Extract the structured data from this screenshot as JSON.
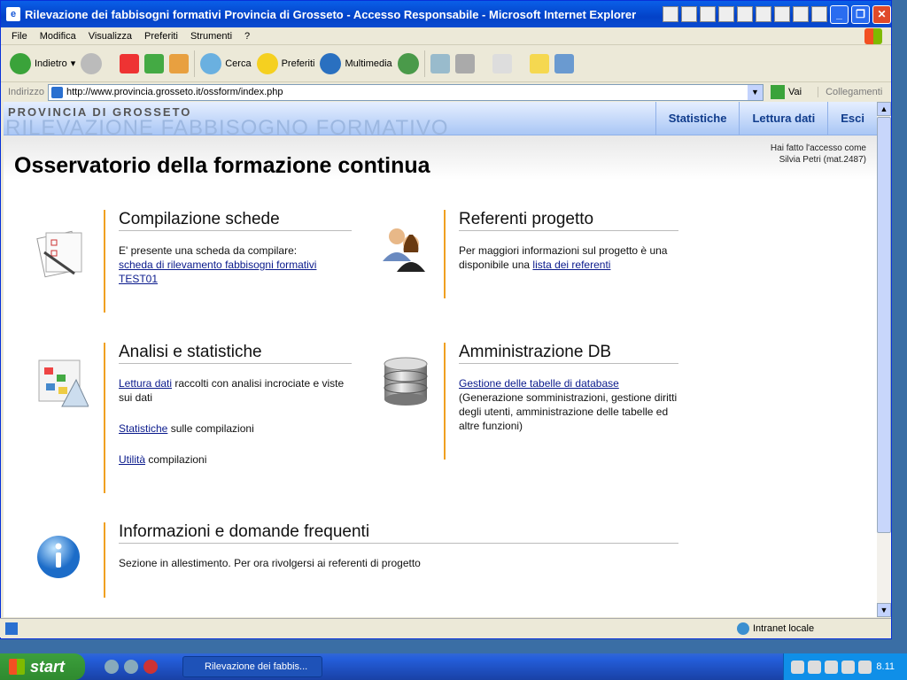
{
  "window": {
    "title": "Rilevazione dei fabbisogni formativi Provincia di Grosseto - Accesso Responsabile - Microsoft Internet Explorer"
  },
  "menu": [
    "File",
    "Modifica",
    "Visualizza",
    "Preferiti",
    "Strumenti",
    "?"
  ],
  "toolbar": {
    "back": "Indietro",
    "search": "Cerca",
    "favorites": "Preferiti",
    "media": "Multimedia"
  },
  "address": {
    "label": "Indirizzo",
    "url": "http://www.provincia.grosseto.it/ossform/index.php",
    "go": "Vai",
    "links": "Collegamenti"
  },
  "banner": {
    "line1": "PROVINCIA DI GROSSETO",
    "line2": "RILEVAZIONE FABBISOGNO FORMATIVO"
  },
  "nav": [
    "Statistiche",
    "Lettura dati",
    "Esci"
  ],
  "header": {
    "title": "Osservatorio della formazione continua",
    "login_line1": "Hai fatto l'accesso come",
    "login_line2": "Silvia Petri (mat.2487)"
  },
  "sections": {
    "compilazione": {
      "title": "Compilazione schede",
      "text": "E' presente una scheda da compilare:",
      "link": "scheda di rilevamento fabbisogni formativi TEST01"
    },
    "referenti": {
      "title": "Referenti progetto",
      "text": "Per maggiori informazioni sul progetto è una disponibile una ",
      "link": "lista dei referenti"
    },
    "analisi": {
      "title": "Analisi e statistiche",
      "link1": "Lettura dati",
      "text1": " raccolti con analisi incrociate e viste sui dati",
      "link2": "Statistiche",
      "text2": " sulle compilazioni",
      "link3": "Utilità",
      "text3": " compilazioni"
    },
    "admin": {
      "title": "Amministrazione DB",
      "link": "Gestione delle tabelle di database",
      "text": "(Generazione somministrazioni, gestione diritti degli utenti, amministrazione delle tabelle ed altre funzioni)"
    },
    "info": {
      "title": "Informazioni e domande frequenti",
      "text": "Sezione in allestimento. Per ora rivolgersi ai referenti di progetto"
    }
  },
  "status": {
    "zone": "Intranet locale"
  },
  "taskbar": {
    "start": "start",
    "task": "Rilevazione dei fabbis...",
    "clock": "8.11"
  },
  "colors": {
    "accent_bar": "#f0a020",
    "link": "#0a1a8c",
    "nav_text": "#103c8c"
  }
}
